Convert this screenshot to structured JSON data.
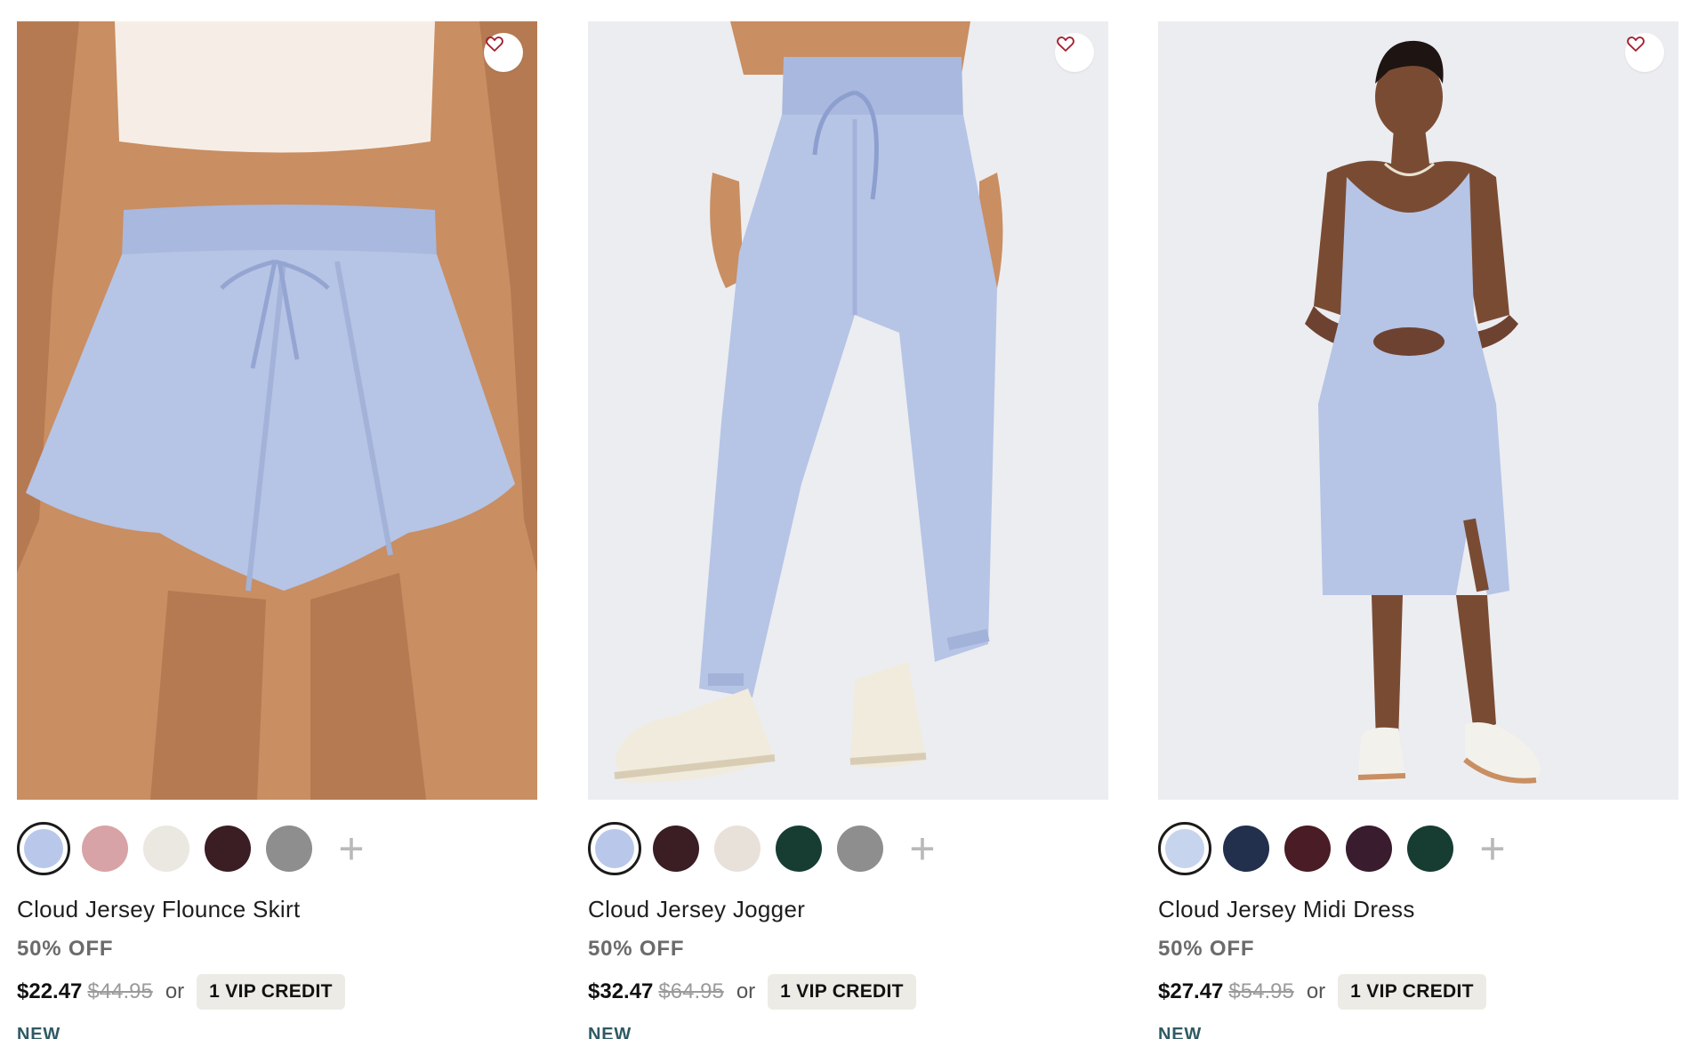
{
  "products": [
    {
      "name": "Cloud Jersey Flounce Skirt",
      "discount": "50% OFF",
      "price": "$22.47",
      "original_price": "$44.95",
      "or_text": "or",
      "vip_label": "1 VIP CREDIT",
      "tag": "NEW",
      "image_icon": "flounce-skirt-photo",
      "swatches": [
        "#b9c8ea",
        "#d8a3a6",
        "#ebe7e1",
        "#3b1d24",
        "#8e8e8e"
      ],
      "selected_swatch": 0,
      "more_label": "+"
    },
    {
      "name": "Cloud Jersey Jogger",
      "discount": "50% OFF",
      "price": "$32.47",
      "original_price": "$64.95",
      "or_text": "or",
      "vip_label": "1 VIP CREDIT",
      "tag": "NEW",
      "image_icon": "jogger-photo",
      "swatches": [
        "#b9c8ea",
        "#3b1d24",
        "#e8e1d9",
        "#173d33",
        "#8e8e8e"
      ],
      "selected_swatch": 0,
      "more_label": "+"
    },
    {
      "name": "Cloud Jersey Midi Dress",
      "discount": "50% OFF",
      "price": "$27.47",
      "original_price": "$54.95",
      "or_text": "or",
      "vip_label": "1 VIP CREDIT",
      "tag": "NEW",
      "image_icon": "midi-dress-photo",
      "swatches": [
        "#c7d4ee",
        "#22304d",
        "#4a1c25",
        "#3a1c2f",
        "#173d33"
      ],
      "selected_swatch": 0,
      "more_label": "+"
    }
  ],
  "colors": {
    "garment": "#b6c4e6",
    "garment_shade": "#a3b2d8",
    "skin_warm": "#c98e62",
    "skin_dark": "#7a4b33",
    "background": "#ecedf0",
    "heart": "#a31d2c",
    "tag": "#2e5a63"
  },
  "icons": {
    "favorite": "heart-outline-icon",
    "more": "plus-icon"
  }
}
